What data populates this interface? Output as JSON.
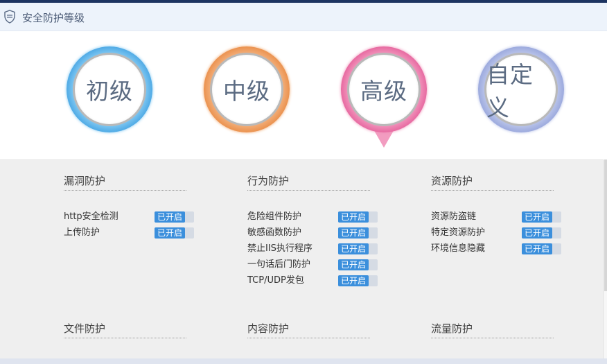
{
  "header": {
    "title": "安全防护等级"
  },
  "levels": [
    {
      "label": "初级"
    },
    {
      "label": "中级"
    },
    {
      "label": "高级",
      "selected": true
    },
    {
      "label": "自定义"
    }
  ],
  "groups": [
    {
      "title": "漏洞防护",
      "items": [
        {
          "name": "http安全检测",
          "status": "已开启"
        },
        {
          "name": "上传防护",
          "status": "已开启"
        }
      ]
    },
    {
      "title": "行为防护",
      "items": [
        {
          "name": "危险组件防护",
          "status": "已开启"
        },
        {
          "name": "敏感函数防护",
          "status": "已开启"
        },
        {
          "name": "禁止IIS执行程序",
          "status": "已开启"
        },
        {
          "name": "一句话后门防护",
          "status": "已开启"
        },
        {
          "name": "TCP/UDP发包",
          "status": "已开启"
        }
      ]
    },
    {
      "title": "资源防护",
      "items": [
        {
          "name": "资源防盗链",
          "status": "已开启"
        },
        {
          "name": "特定资源防护",
          "status": "已开启"
        },
        {
          "name": "环境信息隐藏",
          "status": "已开启"
        }
      ]
    },
    {
      "title": "文件防护",
      "items": []
    },
    {
      "title": "内容防护",
      "items": []
    },
    {
      "title": "流量防护",
      "items": []
    }
  ],
  "colors": {
    "level_low": "#4aa7e4",
    "level_mid": "#ea8f4a",
    "level_high": "#e6659e",
    "level_custom": "#99a7dc",
    "toggle_on": "#3b8fdc"
  }
}
